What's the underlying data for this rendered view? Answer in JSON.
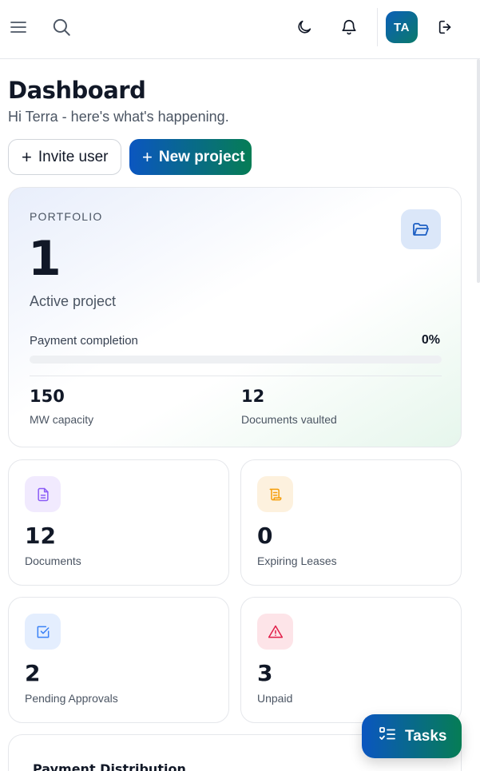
{
  "topbar": {
    "avatar_initials": "TA",
    "icons": [
      "menu-icon",
      "search-icon",
      "moon-icon",
      "bell-icon",
      "logout-icon"
    ]
  },
  "header": {
    "title": "Dashboard",
    "subtitle": "Hi Terra - here's what's happening."
  },
  "actions": {
    "invite_label": "Invite user",
    "new_project_label": "New project"
  },
  "portfolio": {
    "label": "PORTFOLIO",
    "count": "1",
    "caption": "Active project",
    "payment_label": "Payment completion",
    "payment_value": "0%",
    "payment_fraction": 0,
    "stats": [
      {
        "value": "150",
        "label": "MW capacity"
      },
      {
        "value": "12",
        "label": "Documents vaulted"
      }
    ]
  },
  "cards": [
    {
      "value": "12",
      "label": "Documents",
      "icon": "document-icon",
      "accent": "#8b5cf6"
    },
    {
      "value": "0",
      "label": "Expiring Leases",
      "icon": "scroll-icon",
      "accent": "#f59e0b"
    },
    {
      "value": "2",
      "label": "Pending Approvals",
      "icon": "check-square-icon",
      "accent": "#3b82f6"
    },
    {
      "value": "3",
      "label": "Unpaid",
      "icon": "alert-triangle-icon",
      "accent": "#e11d48"
    }
  ],
  "chart_section": {
    "title": "Payment Distribution"
  },
  "tasks": {
    "label": "Tasks"
  },
  "colors": {
    "brand_blue": "#0b56c0",
    "brand_green": "#067d55"
  }
}
